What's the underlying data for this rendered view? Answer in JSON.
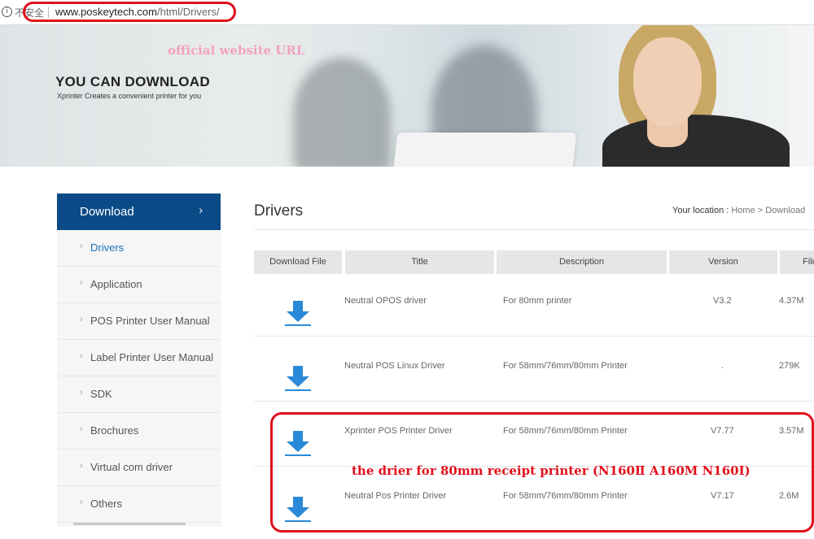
{
  "address_bar": {
    "insecure_label": "不安全",
    "url_domain": "www.poskeytech.com",
    "url_path": "/html/Drivers/"
  },
  "banner": {
    "heading": "YOU CAN DOWNLOAD",
    "subheading": "Xprinter Creates a convenient printer for you",
    "annotation": "official website URL"
  },
  "sidebar": {
    "header": "Download",
    "items": [
      {
        "label": "Drivers",
        "active": true
      },
      {
        "label": "Application"
      },
      {
        "label": "POS Printer User Manual"
      },
      {
        "label": "Label Printer User Manual"
      },
      {
        "label": "SDK"
      },
      {
        "label": "Brochures"
      },
      {
        "label": "Virtual com driver"
      },
      {
        "label": "Others"
      }
    ]
  },
  "main": {
    "title": "Drivers",
    "breadcrumb": {
      "prefix": "Your location :",
      "home": "Home",
      "sep": ">",
      "current": "Download"
    },
    "table": {
      "headers": [
        "Download File",
        "Title",
        "Description",
        "Version",
        "File"
      ],
      "rows": [
        {
          "title": "Neutral OPOS driver",
          "description": "For 80mm printer",
          "version": "V3.2",
          "size": "4.37M"
        },
        {
          "title": "Neutral POS Linux Driver",
          "description": "For 58mm/76mm/80mm Printer",
          "version": ".",
          "size": "279K"
        },
        {
          "title": "Xprinter POS Printer Driver",
          "description": "For 58mm/76mm/80mm Printer",
          "version": "V7.77",
          "size": "3.57M"
        },
        {
          "title": "Neutral Pos Printer Driver",
          "description": "For 58mm/76mm/80mm Printer",
          "version": "V7.17",
          "size": "2.6M"
        }
      ]
    },
    "annotation": "the drier  for 80mm receipt printer (N160Ⅱ  A160M N160I)"
  },
  "colors": {
    "sidebar_header": "#0a4a86",
    "active_link": "#1b6fb8",
    "download_icon": "#2a8ad8",
    "annotation_red": "#e0101c"
  }
}
